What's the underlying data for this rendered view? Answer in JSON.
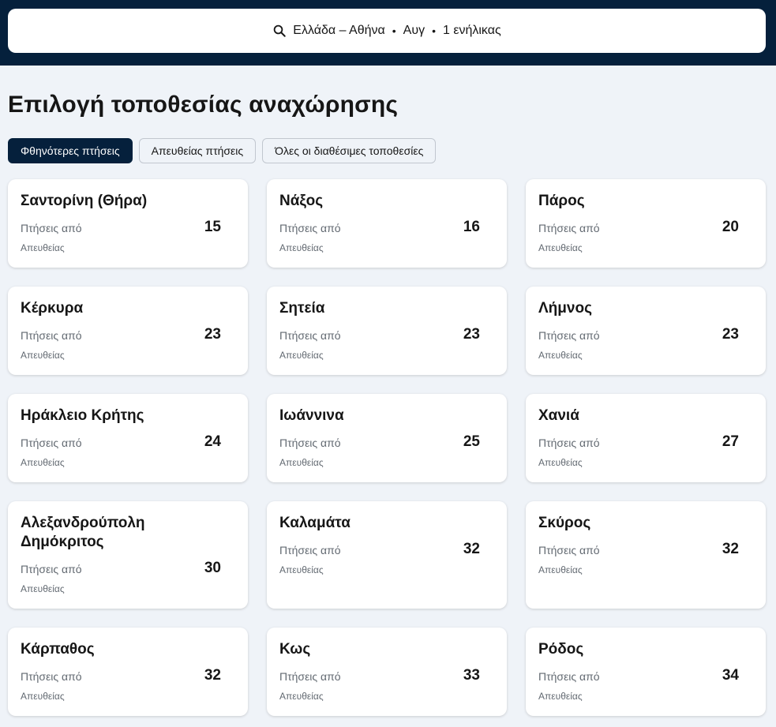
{
  "search": {
    "destination": "Ελλάδα – Αθήνα",
    "date": "Αυγ",
    "travellers": "1 ενήλικας",
    "icon": "search-icon"
  },
  "page": {
    "title": "Επιλογή τοποθεσίας αναχώρησης"
  },
  "filters": [
    {
      "label": "Φθηνότερες πτήσεις",
      "active": true
    },
    {
      "label": "Απευθείας πτήσεις",
      "active": false
    },
    {
      "label": "Όλες οι διαθέσιμες τοποθεσίες",
      "active": false
    }
  ],
  "cards": [
    {
      "name": "Σαντορίνη (Θήρα)",
      "from": "Πτήσεις από",
      "direct": "Απευθείας",
      "price": "15"
    },
    {
      "name": "Νάξος",
      "from": "Πτήσεις από",
      "direct": "Απευθείας",
      "price": "16"
    },
    {
      "name": "Πάρος",
      "from": "Πτήσεις από",
      "direct": "Απευθείας",
      "price": "20"
    },
    {
      "name": "Κέρκυρα",
      "from": "Πτήσεις από",
      "direct": "Απευθείας",
      "price": "23"
    },
    {
      "name": "Σητεία",
      "from": "Πτήσεις από",
      "direct": "Απευθείας",
      "price": "23"
    },
    {
      "name": "Λήμνος",
      "from": "Πτήσεις από",
      "direct": "Απευθείας",
      "price": "23"
    },
    {
      "name": "Ηράκλειο Κρήτης",
      "from": "Πτήσεις από",
      "direct": "Απευθείας",
      "price": "24"
    },
    {
      "name": "Ιωάννινα",
      "from": "Πτήσεις από",
      "direct": "Απευθείας",
      "price": "25"
    },
    {
      "name": "Χανιά",
      "from": "Πτήσεις από",
      "direct": "Απευθείας",
      "price": "27"
    },
    {
      "name": "Αλεξανδρούπολη Δημόκριτος",
      "from": "Πτήσεις από",
      "direct": "Απευθείας",
      "price": "30"
    },
    {
      "name": "Καλαμάτα",
      "from": "Πτήσεις από",
      "direct": "Απευθείας",
      "price": "32"
    },
    {
      "name": "Σκύρος",
      "from": "Πτήσεις από",
      "direct": "Απευθείας",
      "price": "32"
    },
    {
      "name": "Κάρπαθος",
      "from": "Πτήσεις από",
      "direct": "Απευθείας",
      "price": "32"
    },
    {
      "name": "Κως",
      "from": "Πτήσεις από",
      "direct": "Απευθείας",
      "price": "33"
    },
    {
      "name": "Ρόδος",
      "from": "Πτήσεις από",
      "direct": "Απευθείας",
      "price": "34"
    }
  ],
  "colors": {
    "header_bg": "#05203c",
    "page_bg": "#eff3f8",
    "active_chip": "#05203c"
  }
}
